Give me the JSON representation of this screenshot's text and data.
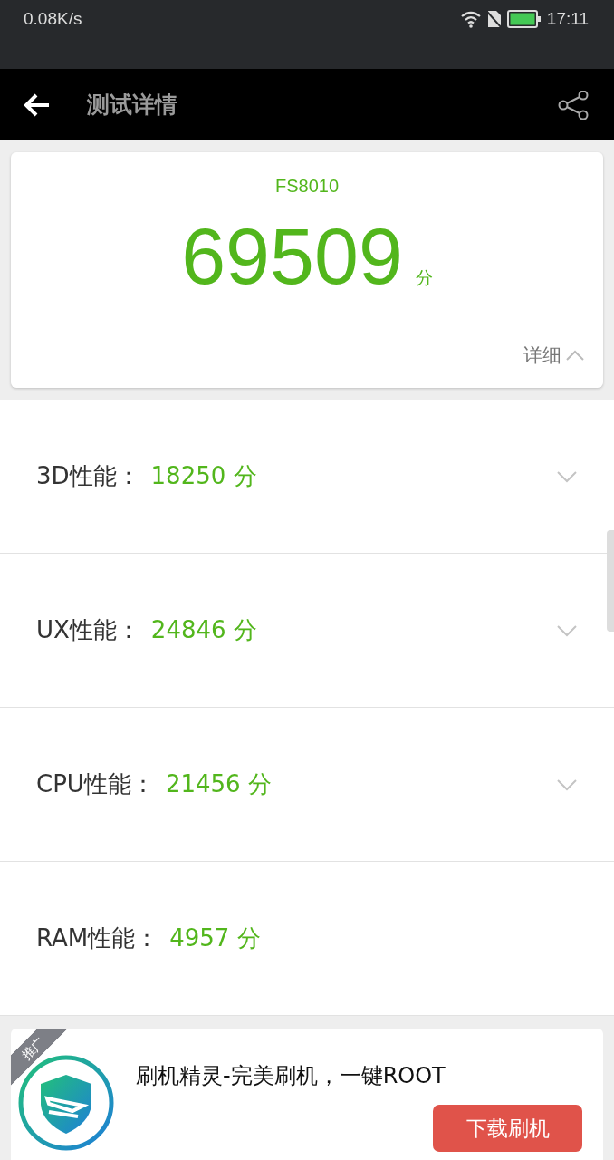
{
  "status_bar": {
    "speed": "0.08K/s",
    "time": "17:11"
  },
  "toolbar": {
    "title": "测试详情"
  },
  "summary": {
    "device": "FS8010",
    "score": "69509",
    "unit": "分",
    "detail": {
      "label": "详细",
      "expanded": true
    }
  },
  "categories": [
    {
      "label": "3D性能：",
      "score": "18250 分",
      "kind": "expandable"
    },
    {
      "label": "UX性能：",
      "score": "24846 分",
      "kind": "expandable"
    },
    {
      "label": "CPU性能：",
      "score": "21456 分",
      "kind": "expandable"
    },
    {
      "label": "RAM性能：",
      "score": "4957 分",
      "kind": "plain"
    }
  ],
  "ad": {
    "tag": "推广",
    "title": "刷机精灵-完美刷机，一键ROOT",
    "button": "下载刷机"
  }
}
